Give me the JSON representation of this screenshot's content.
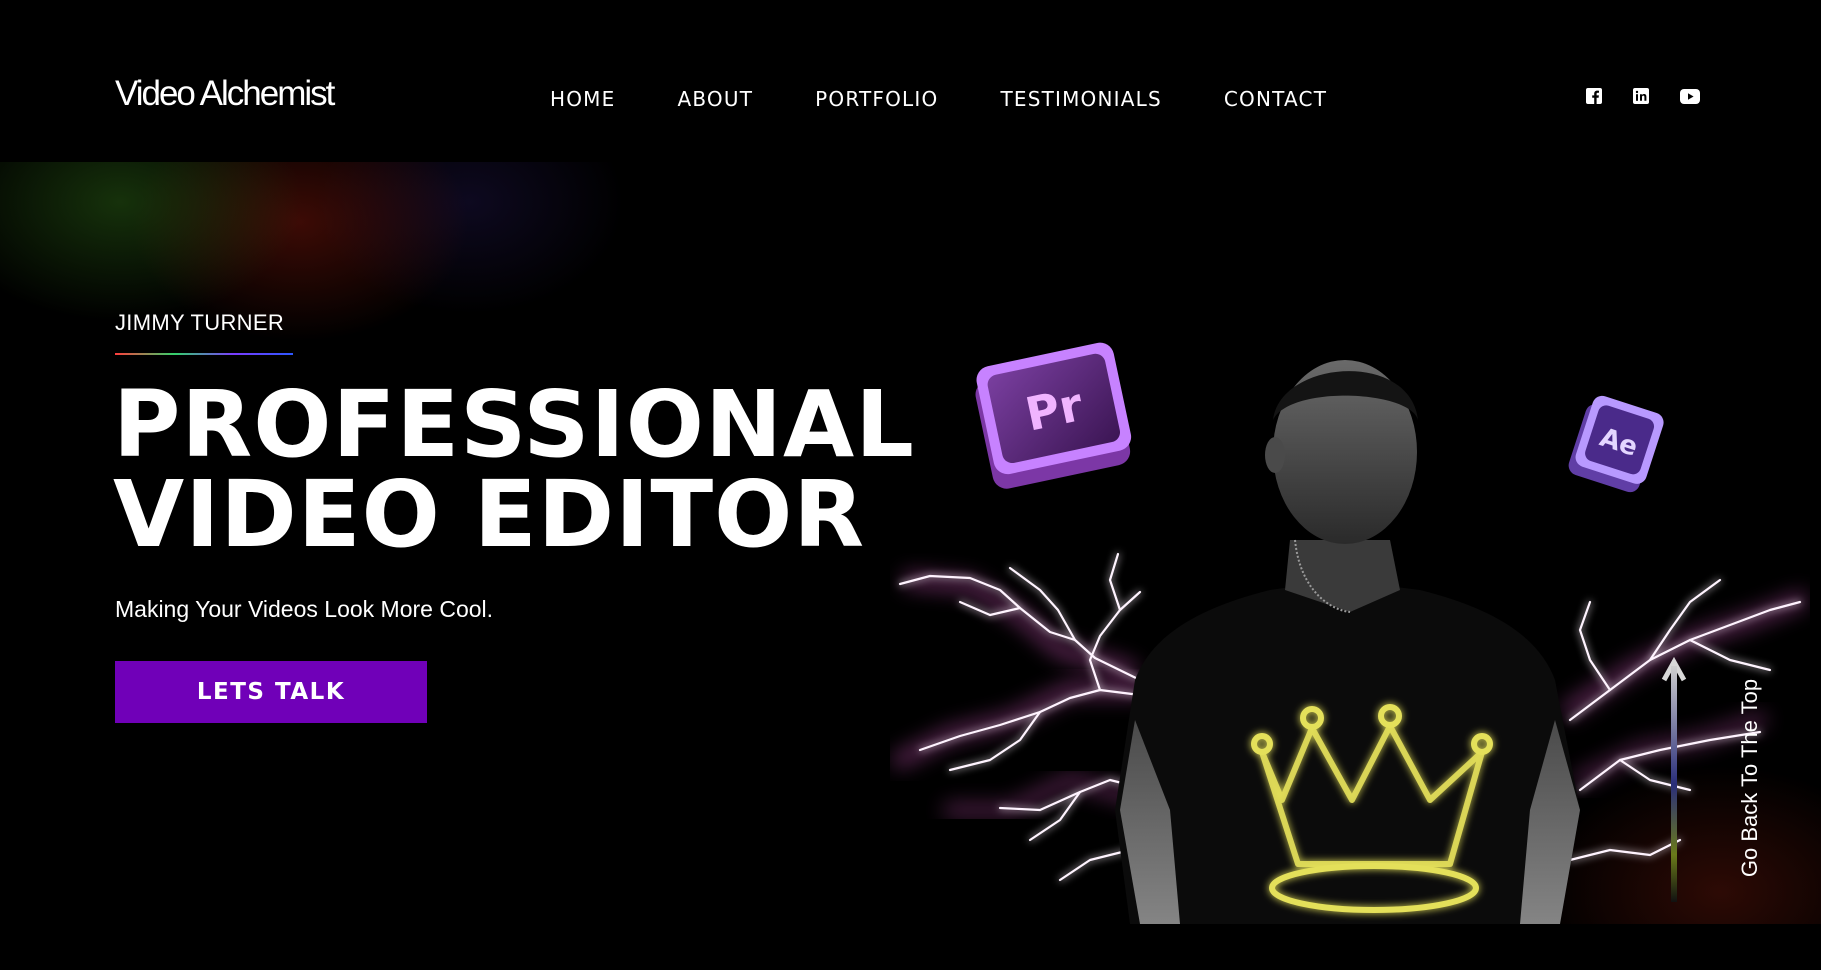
{
  "brand": {
    "logo_text": "Video Alchemist"
  },
  "nav": {
    "items": [
      {
        "label": "HOME"
      },
      {
        "label": "ABOUT"
      },
      {
        "label": "PORTFOLIO"
      },
      {
        "label": "TESTIMONIALS"
      },
      {
        "label": "CONTACT"
      }
    ]
  },
  "social": {
    "icons": [
      "facebook-icon",
      "linkedin-icon",
      "youtube-icon"
    ]
  },
  "hero": {
    "name": "JIMMY TURNER",
    "headline_line1": "PROFESSIONAL",
    "headline_line2": "VIDEO EDITOR",
    "tagline": "Making Your Videos Look More Cool.",
    "cta_label": "LETS TALK",
    "badges": {
      "premiere": "Pr",
      "after_effects": "Ae"
    }
  },
  "back_to_top": {
    "label": "Go Back To The Top"
  },
  "colors": {
    "background": "#000000",
    "accent_purple": "#7000b8",
    "lightning_pink": "#ff66e0",
    "crown_yellow": "#e4e05a"
  }
}
